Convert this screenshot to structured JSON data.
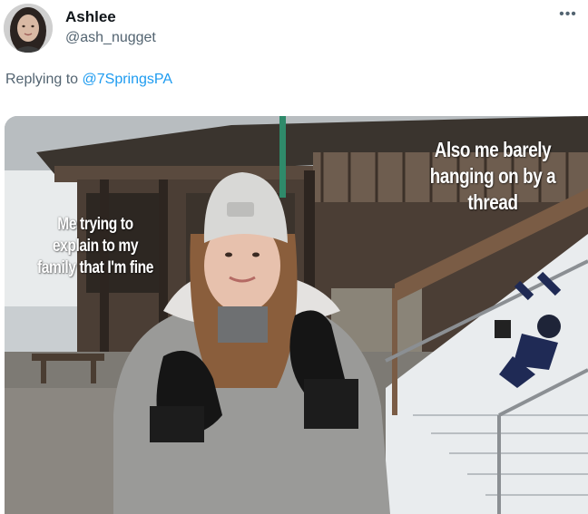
{
  "tweet": {
    "display_name": "Ashlee",
    "handle": "@ash_nugget",
    "more_icon": "more-dots-icon",
    "reply_prefix": "Replying to",
    "reply_mention": "@7SpringsPA",
    "mention_color": "#1d9bf0",
    "secondary_color": "#536471"
  },
  "media": {
    "caption_left": "Me trying to explain to my family that I'm fine",
    "caption_right": "Also me barely hanging on by a thread"
  }
}
